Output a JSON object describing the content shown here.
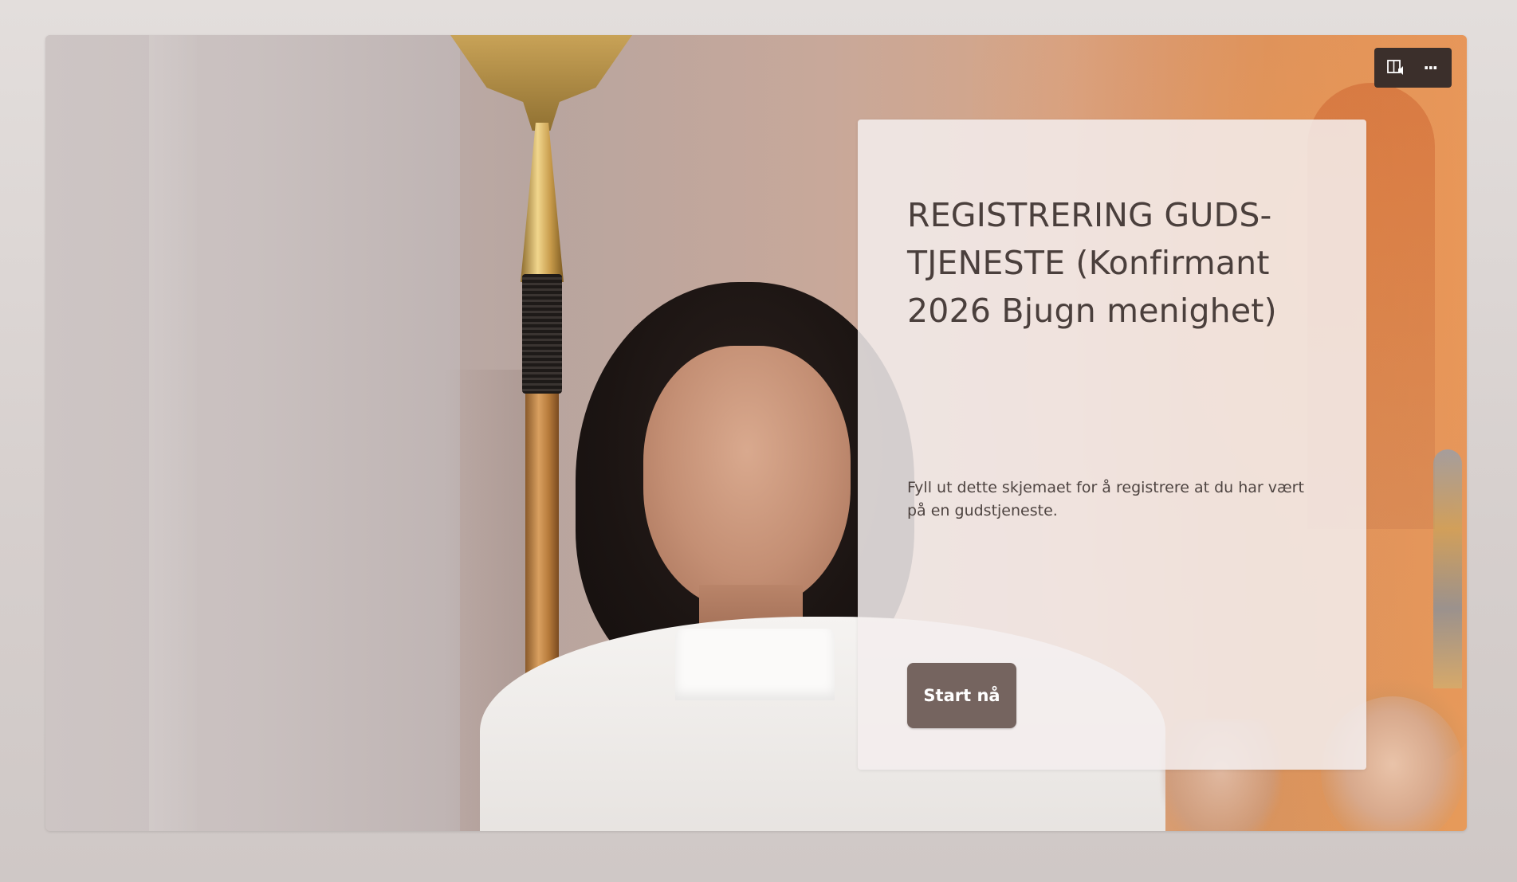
{
  "form": {
    "title": "REGISTRERING GUDS-TJENESTE (Konfirmant 2026 Bjugn menighet)",
    "description": "Fyll ut dette skjemaet for å registrere at du har vært på en gudstjeneste.",
    "start_label": "Start nå"
  },
  "toolbar": {
    "immersive_reader_icon": "immersive-reader-icon",
    "more_icon": "more-options-icon",
    "more_glyph": "···"
  },
  "colors": {
    "page_bg": "#d9d3d1",
    "card_bg": "#f3eeed",
    "title_text": "#4a3f3c",
    "button_bg": "#75645f",
    "toolbar_bg": "#3b2f2b"
  }
}
